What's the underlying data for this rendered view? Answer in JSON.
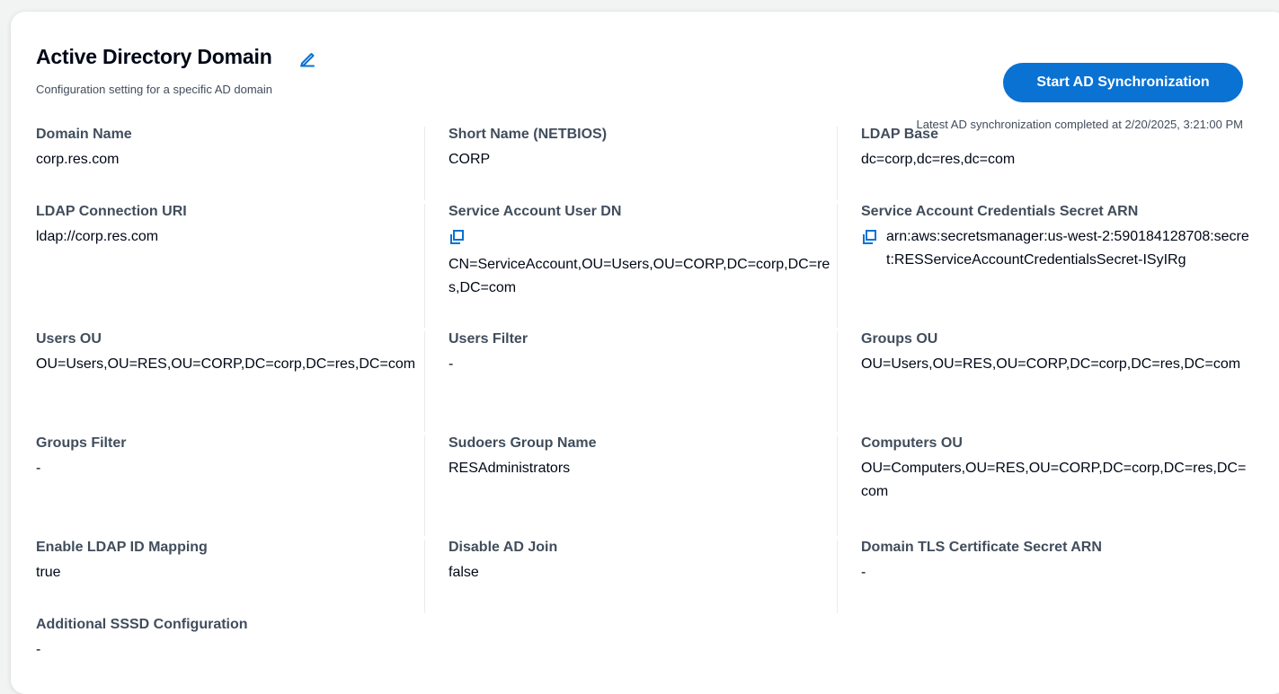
{
  "header": {
    "title": "Active Directory Domain",
    "subtitle": "Configuration setting for a specific AD domain",
    "sync_button_label": "Start AD Synchronization",
    "sync_status": "Latest AD synchronization completed at 2/20/2025, 3:21:00 PM"
  },
  "fields": {
    "domain_name": {
      "label": "Domain Name",
      "value": "corp.res.com"
    },
    "short_name": {
      "label": "Short Name (NETBIOS)",
      "value": "CORP"
    },
    "ldap_base": {
      "label": "LDAP Base",
      "value": "dc=corp,dc=res,dc=com"
    },
    "ldap_connection_uri": {
      "label": "LDAP Connection URI",
      "value": "ldap://corp.res.com"
    },
    "service_account_user_dn": {
      "label": "Service Account User DN",
      "value": "CN=ServiceAccount,OU=Users,OU=CORP,DC=corp,DC=res,DC=com"
    },
    "service_account_secret_arn": {
      "label": "Service Account Credentials Secret ARN",
      "value": "arn:aws:secretsmanager:us-west-2:590184128708:secret:RESServiceAccountCredentialsSecret-ISyIRg"
    },
    "users_ou": {
      "label": "Users OU",
      "value": "OU=Users,OU=RES,OU=CORP,DC=corp,DC=res,DC=com"
    },
    "users_filter": {
      "label": "Users Filter",
      "value": "-"
    },
    "groups_ou": {
      "label": "Groups OU",
      "value": "OU=Users,OU=RES,OU=CORP,DC=corp,DC=res,DC=com"
    },
    "groups_filter": {
      "label": "Groups Filter",
      "value": "-"
    },
    "sudoers_group_name": {
      "label": "Sudoers Group Name",
      "value": "RESAdministrators"
    },
    "computers_ou": {
      "label": "Computers OU",
      "value": "OU=Computers,OU=RES,OU=CORP,DC=corp,DC=res,DC=com"
    },
    "enable_ldap_id_mapping": {
      "label": "Enable LDAP ID Mapping",
      "value": "true"
    },
    "disable_ad_join": {
      "label": "Disable AD Join",
      "value": "false"
    },
    "domain_tls_secret_arn": {
      "label": "Domain TLS Certificate Secret ARN",
      "value": "-"
    },
    "additional_sssd_config": {
      "label": "Additional SSSD Configuration",
      "value": "-"
    }
  },
  "icons": {
    "edit": "edit-pencil-icon",
    "copy": "copy-icon"
  },
  "colors": {
    "accent": "#0972d3",
    "label": "#414d5c",
    "text": "#000716",
    "divider": "#e9ebed"
  }
}
